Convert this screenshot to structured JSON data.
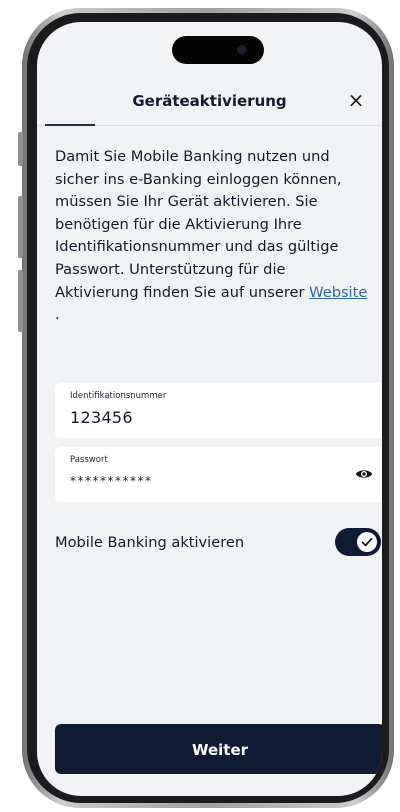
{
  "header": {
    "title": "Geräteaktivierung",
    "close_icon": "×"
  },
  "intro": {
    "text": "Damit Sie Mobile Banking nutzen und sicher ins e-Banking einloggen können, müssen Sie Ihr Gerät aktivieren. Sie benötigen für die Aktivierung Ihre Identifikationsnummer und das gültige Passwort. Unterstützung für die Aktivierung finden Sie auf unserer ",
    "link_label": "Website",
    "suffix": " ."
  },
  "form": {
    "id_field": {
      "label": "Identifikationsnummer",
      "value": "123456"
    },
    "password_field": {
      "label": "Passwort",
      "value": "***********"
    }
  },
  "toggle": {
    "label": "Mobile Banking aktivieren",
    "checked": true
  },
  "cta": {
    "label": "Weiter"
  },
  "colors": {
    "primary": "#0f1a35",
    "link": "#2c66b8",
    "screen_bg": "#f1f3f5"
  },
  "icons": {
    "close": "close-icon",
    "eye": "eye-icon",
    "toggle_check": "check-icon"
  }
}
